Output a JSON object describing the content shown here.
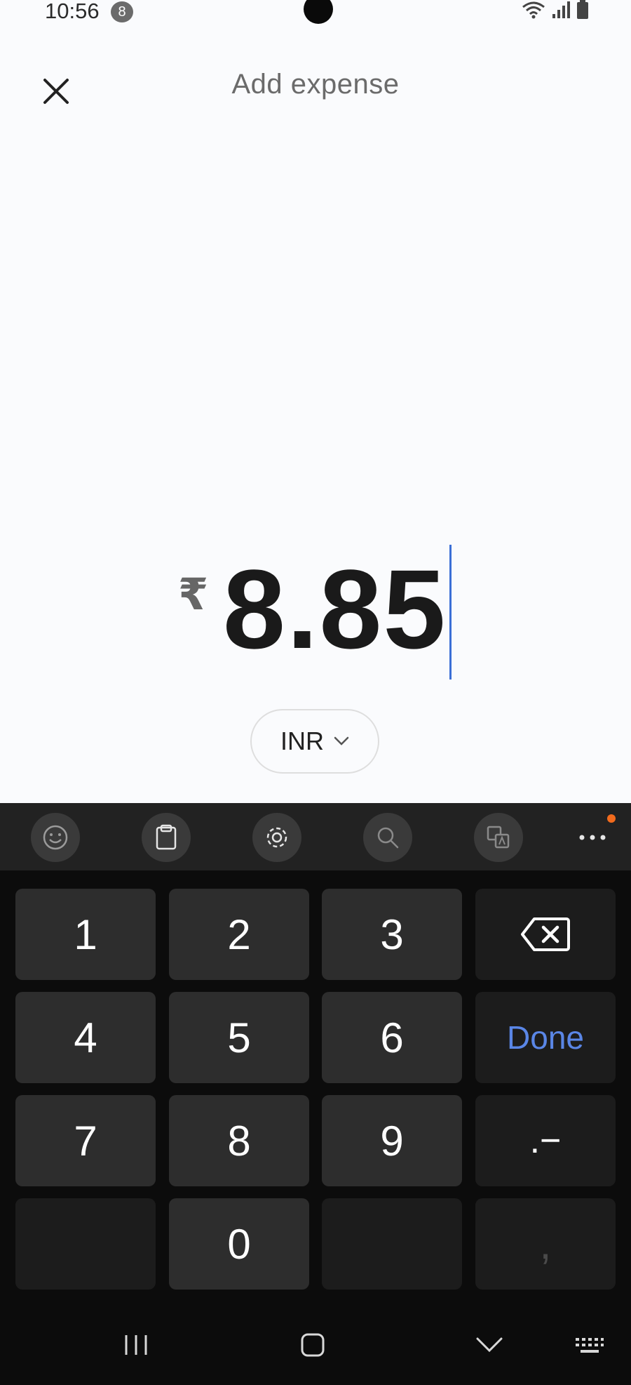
{
  "status_bar": {
    "time": "10:56",
    "notification_count": "8"
  },
  "app_bar": {
    "title": "Add expense"
  },
  "amount": {
    "currency_symbol": "₹",
    "value": "8.85"
  },
  "currency_selector": {
    "code": "INR"
  },
  "keyboard": {
    "keys": {
      "k1": "1",
      "k2": "2",
      "k3": "3",
      "k4": "4",
      "k5": "5",
      "k6": "6",
      "done": "Done",
      "k7": "7",
      "k8": "8",
      "k9": "9",
      "dot_minus": ".−",
      "k0": "0",
      "comma": ","
    },
    "toolbar": [
      "emoji-icon",
      "clipboard-icon",
      "settings-gear-icon",
      "search-icon",
      "translate-icon",
      "more-options-icon"
    ]
  },
  "colors": {
    "accent": "#3b6fd6",
    "done_text": "#5a86e6",
    "notification_dot": "#f26b1d"
  }
}
